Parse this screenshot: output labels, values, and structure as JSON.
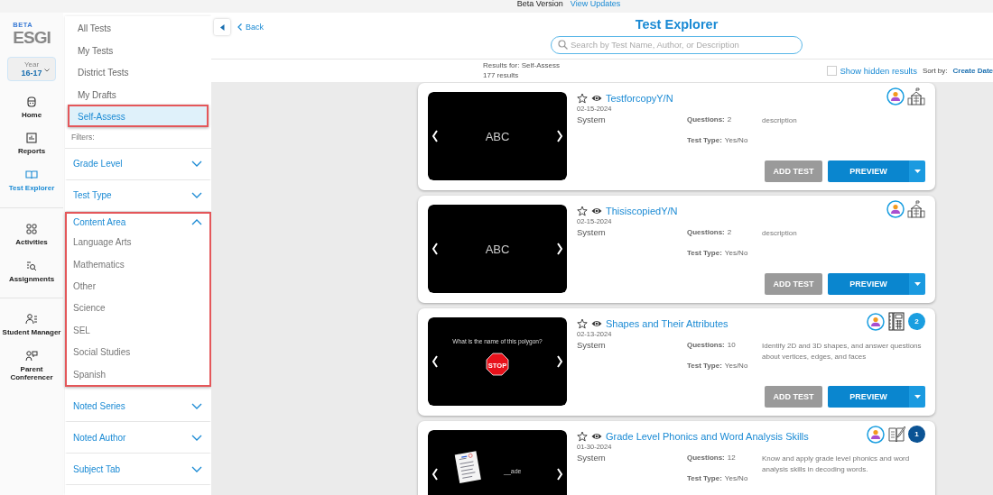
{
  "top_banner": {
    "label": "Beta Version",
    "link": "View Updates"
  },
  "nav": {
    "logo": {
      "badge": "BETA",
      "name": "ESGI"
    },
    "year": {
      "label": "Year",
      "value": "16-17"
    },
    "groups": [
      [
        {
          "label": "Home",
          "selected": false
        },
        {
          "label": "Reports",
          "selected": false
        },
        {
          "label": "Test Explorer",
          "selected": true
        }
      ],
      [
        {
          "label": "Activities",
          "selected": false
        },
        {
          "label": "Assignments",
          "selected": false
        }
      ],
      [
        {
          "label": "Student Manager",
          "selected": false
        },
        {
          "label": "Parent Conferencer",
          "selected": false
        }
      ]
    ]
  },
  "sidebar": {
    "views": [
      {
        "label": "All Tests",
        "selected": false,
        "outlined": false
      },
      {
        "label": "My Tests",
        "selected": false,
        "outlined": false
      },
      {
        "label": "District Tests",
        "selected": false,
        "outlined": false
      },
      {
        "label": "My Drafts",
        "selected": false,
        "outlined": false
      },
      {
        "label": "Self-Assess",
        "selected": true,
        "outlined": true
      }
    ],
    "filters_label": "Filters:",
    "filters": [
      {
        "label": "Grade Level",
        "expanded": false,
        "outlined": false
      },
      {
        "label": "Test Type",
        "expanded": false,
        "outlined": false
      },
      {
        "label": "Content Area",
        "expanded": true,
        "outlined": true,
        "options": [
          "Language Arts",
          "Mathematics",
          "Other",
          "Science",
          "SEL",
          "Social Studies",
          "Spanish"
        ]
      },
      {
        "label": "Noted Series",
        "expanded": false,
        "outlined": false
      },
      {
        "label": "Noted Author",
        "expanded": false,
        "outlined": false
      },
      {
        "label": "Subject Tab",
        "expanded": false,
        "outlined": false
      }
    ]
  },
  "header": {
    "back": "Back",
    "title": "Test Explorer",
    "search": {
      "placeholder": "Search by Test Name, Author, or Description"
    },
    "results_for": "Results for: Self-Assess",
    "count": "177 results",
    "show_hidden": {
      "label": "Show hidden results",
      "checked": false
    },
    "sort": {
      "label": "Sort by:",
      "value": "Create Date"
    }
  },
  "cards": [
    {
      "title": "TestforcopyY/N",
      "date": "02-15-2024",
      "author": "System",
      "questions_label": "Questions:",
      "questions": "2",
      "type_label": "Test Type:",
      "type": "Yes/No",
      "description": "description",
      "slide": {
        "kind": "text",
        "text": "ABC"
      },
      "add": "ADD TEST",
      "preview": "PREVIEW"
    },
    {
      "title": "ThisiscopiedY/N",
      "date": "02-15-2024",
      "author": "System",
      "questions_label": "Questions:",
      "questions": "2",
      "type_label": "Test Type:",
      "type": "Yes/No",
      "description": "description",
      "slide": {
        "kind": "text",
        "text": "ABC"
      },
      "add": "ADD TEST",
      "preview": "PREVIEW"
    },
    {
      "title": "Shapes and Their Attributes",
      "date": "02-13-2024",
      "author": "System",
      "questions_label": "Questions:",
      "questions": "10",
      "type_label": "Test Type:",
      "type": "Yes/No",
      "description": "Identify 2D and 3D shapes, and answer questions about vertices, edges, and faces",
      "slide": {
        "kind": "sign",
        "question": "What is the name of this polygon?",
        "sign": "STOP"
      },
      "badge": {
        "text": "2",
        "color": "#1a9ee0"
      },
      "add": "ADD TEST",
      "preview": "PREVIEW"
    },
    {
      "title": "Grade Level Phonics and Word Analysis Skills",
      "date": "01-30-2024",
      "author": "System",
      "questions_label": "Questions:",
      "questions": "12",
      "type_label": "Test Type:",
      "type": "Yes/No",
      "description": "Know and apply grade level phonics and word analysis skills in decoding words.",
      "slide": {
        "kind": "worksheet",
        "text": "__ade"
      },
      "badge": {
        "text": "1",
        "color": "#0b5394"
      }
    }
  ]
}
